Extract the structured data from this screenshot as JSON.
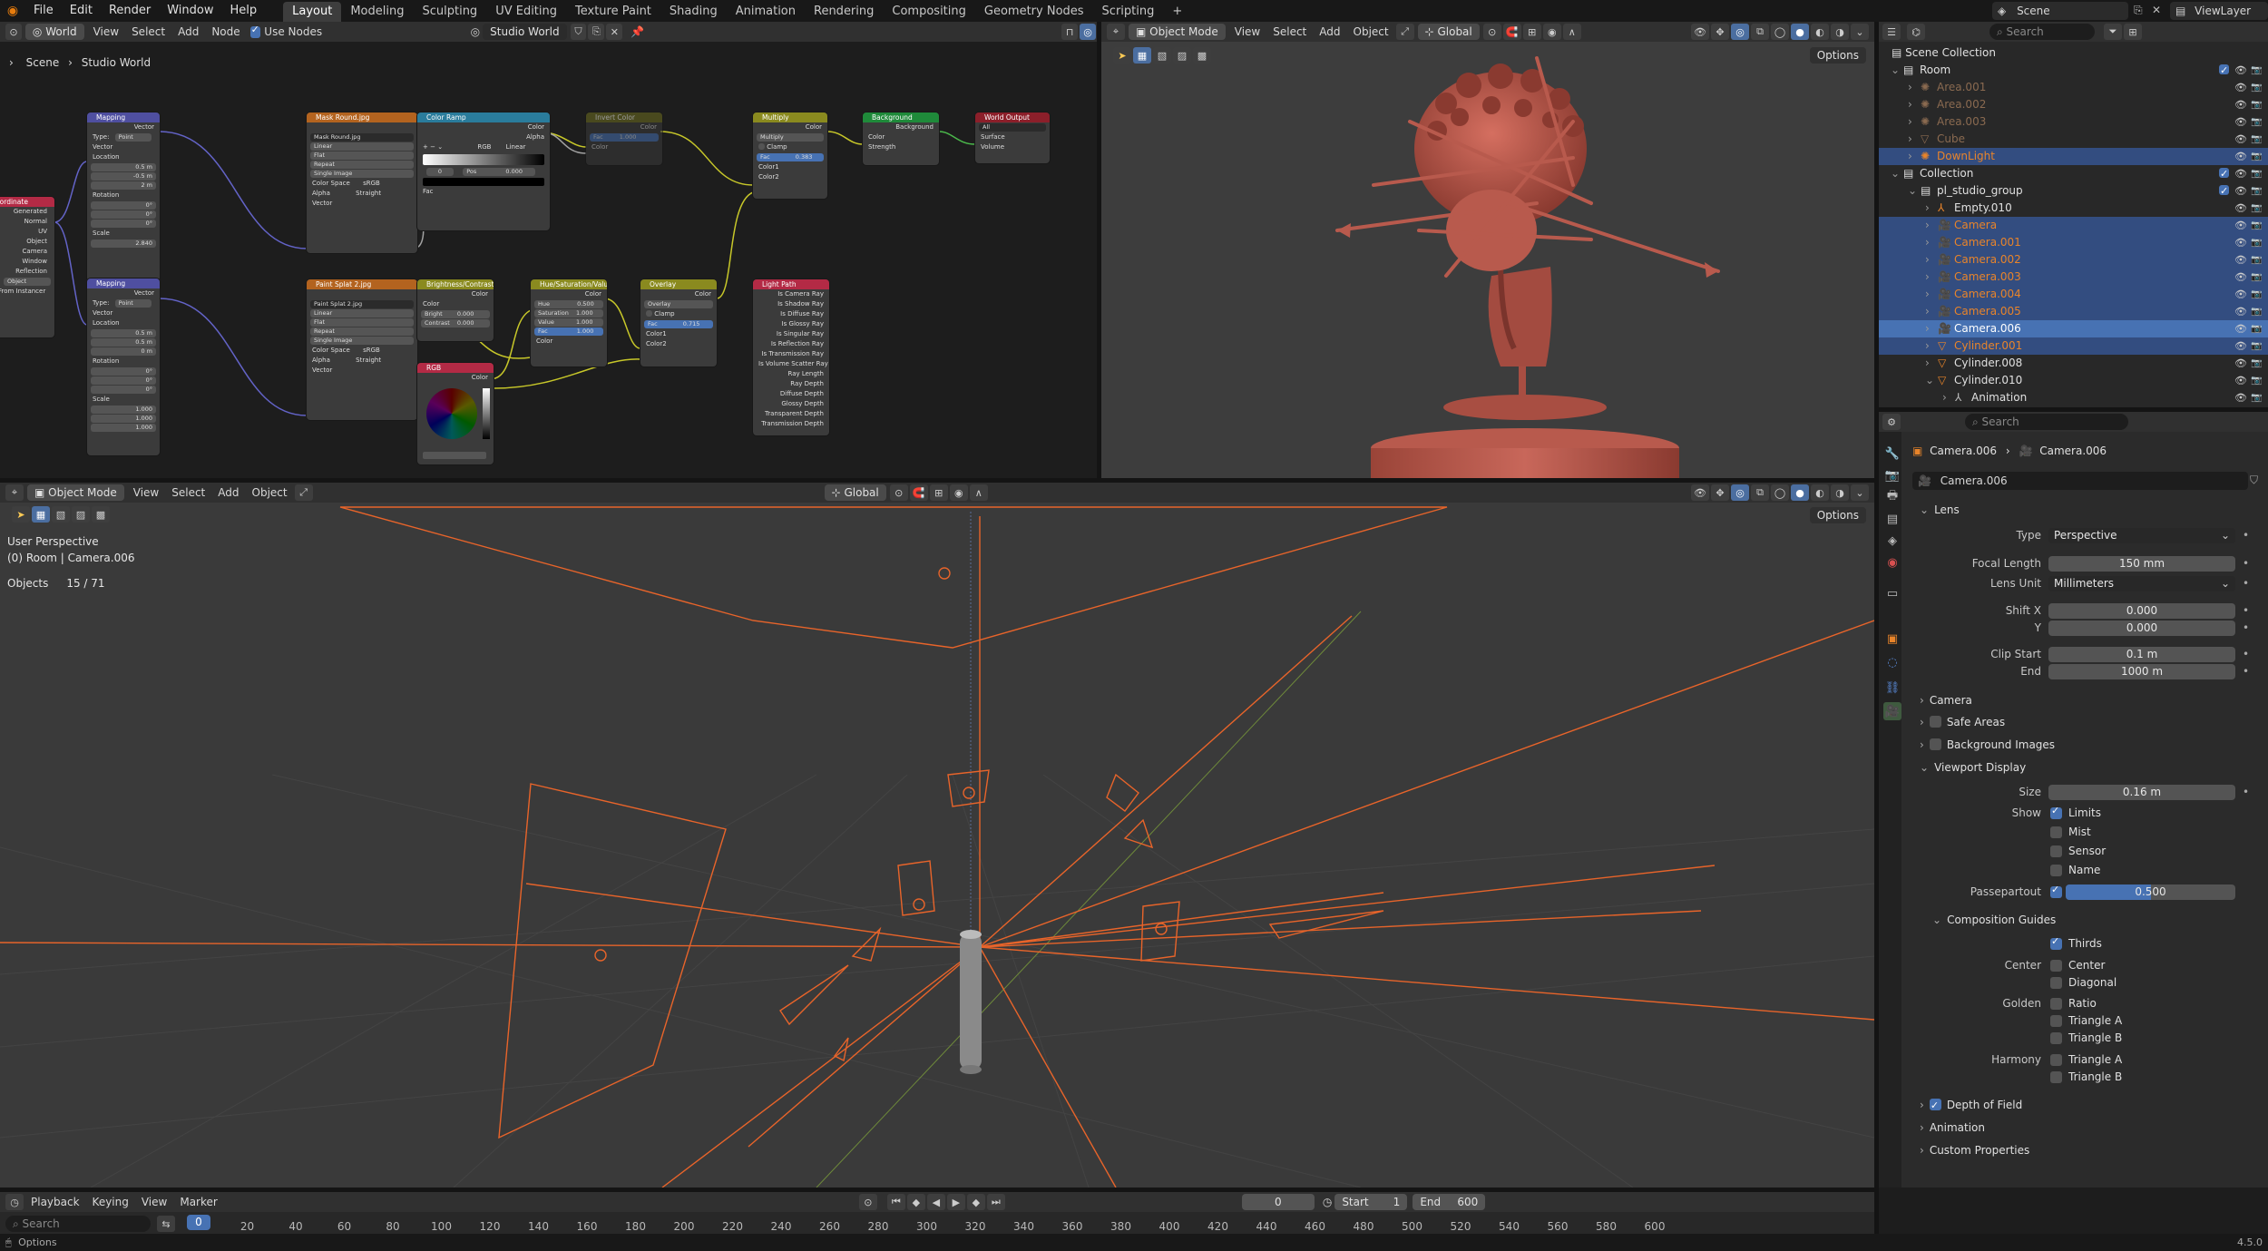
{
  "topbar": {
    "menus": [
      "File",
      "Edit",
      "Render",
      "Window",
      "Help"
    ],
    "workspaces": [
      "Layout",
      "Modeling",
      "Sculpting",
      "UV Editing",
      "Texture Paint",
      "Shading",
      "Animation",
      "Rendering",
      "Compositing",
      "Geometry Nodes",
      "Scripting"
    ],
    "active_workspace": "Layout",
    "add_tab": "+",
    "scene_name": "Scene",
    "view_layer": "ViewLayer"
  },
  "node_editor": {
    "header": {
      "editor": "World",
      "menus": [
        "View",
        "Select",
        "Add",
        "Node"
      ],
      "use_nodes": "Use Nodes",
      "world_name": "Studio World"
    },
    "breadcrumb": {
      "scene": "Scene",
      "world": "Studio World"
    },
    "nodes": {
      "texcoord": {
        "title": "Texture Coordinate",
        "outputs": [
          "Generated",
          "Normal",
          "UV",
          "Object",
          "Camera",
          "Window",
          "Reflection"
        ],
        "object_field": "Object",
        "from_instancer": "From Instancer"
      },
      "mapping1": {
        "title": "Mapping",
        "out": "Vector",
        "type_label": "Type:",
        "type_val": "Point",
        "vector": "Vector",
        "location": "Location",
        "loc": [
          "0.5 m",
          "-0.5 m",
          "2 m"
        ],
        "rotation": "Rotation",
        "rot": [
          "0°",
          "0°",
          "0°"
        ],
        "scale": "Scale",
        "scl": [
          "2.840"
        ]
      },
      "mapping2": {
        "title": "Mapping",
        "out": "Vector",
        "type_label": "Type:",
        "type_val": "Point",
        "vector": "Vector",
        "location": "Location",
        "loc": [
          "0.5 m",
          "0.5 m",
          "0 m"
        ],
        "rotation": "Rotation",
        "rot": [
          "0°",
          "0°",
          "0°"
        ],
        "scale": "Scale",
        "scl": [
          "1.000",
          "1.000",
          "1.000"
        ]
      },
      "mask": {
        "title": "Mask Round.jpg",
        "img": "Mask Round.jpg",
        "rows": [
          "Linear",
          "Flat",
          "Repeat",
          "Single Image"
        ],
        "cs_label": "Color Space",
        "cs_val": "sRGB",
        "alpha_label": "Alpha",
        "alpha_val": "Straight",
        "vector": "Vector"
      },
      "colorramp": {
        "title": "Color Ramp",
        "color": "Color",
        "alpha": "Alpha",
        "mode": "RGB",
        "interp": "Linear",
        "pos_idx": "0",
        "pos_label": "Pos",
        "pos_val": "0.000",
        "fac": "Fac"
      },
      "invert": {
        "title": "Invert Color",
        "color": "Color",
        "fac": "Fac",
        "fac_val": "1.000",
        "color_in": "Color"
      },
      "paint": {
        "title": "Paint Splat 2.jpg",
        "img": "Paint Splat 2.jpg",
        "rows": [
          "Linear",
          "Flat",
          "Repeat",
          "Single Image"
        ],
        "cs_label": "Color Space",
        "cs_val": "sRGB",
        "alpha_label": "Alpha",
        "alpha_val": "Straight",
        "vector": "Vector"
      },
      "bright": {
        "title": "Brightness/Contrast",
        "color": "Color",
        "color_in": "Color",
        "bright": "Bright",
        "bright_val": "0.000",
        "contrast": "Contrast",
        "contrast_val": "0.000"
      },
      "rgb": {
        "title": "RGB",
        "color": "Color"
      },
      "hsv": {
        "title": "Hue/Saturation/Value",
        "color": "Color",
        "hue": "Hue",
        "hue_val": "0.500",
        "sat": "Saturation",
        "sat_val": "1.000",
        "val": "Value",
        "val_val": "1.000",
        "fac": "Fac",
        "fac_val": "1.000",
        "color_in": "Color"
      },
      "overlay": {
        "title": "Overlay",
        "color": "Color",
        "mode": "Overlay",
        "clamp": "Clamp",
        "fac": "Fac",
        "fac_val": "0.715",
        "c1": "Color1",
        "c2": "Color2"
      },
      "multiply": {
        "title": "Multiply",
        "color": "Color",
        "mode": "Multiply",
        "clamp": "Clamp",
        "fac": "Fac",
        "fac_val": "0.383",
        "c1": "Color1",
        "c2": "Color2"
      },
      "lightpath": {
        "title": "Light Path",
        "outs": [
          "Is Camera Ray",
          "Is Shadow Ray",
          "Is Diffuse Ray",
          "Is Glossy Ray",
          "Is Singular Ray",
          "Is Reflection Ray",
          "Is Transmission Ray",
          "Is Volume Scatter Ray",
          "Ray Length",
          "Ray Depth",
          "Diffuse Depth",
          "Glossy Depth",
          "Transparent Depth",
          "Transmission Depth"
        ]
      },
      "background": {
        "title": "Background",
        "background": "Background",
        "color": "Color",
        "strength": "Strength"
      },
      "worldout": {
        "title": "World Output",
        "target": "All",
        "surface": "Surface",
        "volume": "Volume"
      }
    }
  },
  "top_viewport": {
    "header": {
      "mode": "Object Mode",
      "menus": [
        "View",
        "Select",
        "Add",
        "Object"
      ],
      "orientation": "Global"
    },
    "options": "Options"
  },
  "main_viewport": {
    "header": {
      "mode": "Object Mode",
      "menus": [
        "View",
        "Select",
        "Add",
        "Object"
      ],
      "orientation": "Global"
    },
    "options": "Options",
    "overlay": {
      "view": "User Perspective",
      "context": "(0) Room | Camera.006",
      "objects_label": "Objects",
      "objects_count": "15 / 71"
    }
  },
  "outliner": {
    "search_placeholder": "Search",
    "root": "Scene Collection",
    "rows": [
      {
        "label": "Room",
        "indent": 1,
        "type": "collection",
        "sel": false
      },
      {
        "label": "Area.001",
        "indent": 2,
        "type": "light-dim",
        "sel": false
      },
      {
        "label": "Area.002",
        "indent": 2,
        "type": "light-dim",
        "sel": false
      },
      {
        "label": "Area.003",
        "indent": 2,
        "type": "light-dim",
        "sel": false
      },
      {
        "label": "Cube",
        "indent": 2,
        "type": "mesh-dim",
        "sel": false
      },
      {
        "label": "DownLight",
        "indent": 2,
        "type": "light",
        "sel": true
      },
      {
        "label": "Collection",
        "indent": 1,
        "type": "collection",
        "sel": false
      },
      {
        "label": "pl_studio_group",
        "indent": 2,
        "type": "collection",
        "sel": false
      },
      {
        "label": "Empty.010",
        "indent": 3,
        "type": "empty",
        "sel": false
      },
      {
        "label": "Camera",
        "indent": 3,
        "type": "camera",
        "sel": true
      },
      {
        "label": "Camera.001",
        "indent": 3,
        "type": "camera",
        "sel": true
      },
      {
        "label": "Camera.002",
        "indent": 3,
        "type": "camera",
        "sel": true
      },
      {
        "label": "Camera.003",
        "indent": 3,
        "type": "camera",
        "sel": true
      },
      {
        "label": "Camera.004",
        "indent": 3,
        "type": "camera",
        "sel": true
      },
      {
        "label": "Camera.005",
        "indent": 3,
        "type": "camera",
        "sel": true
      },
      {
        "label": "Camera.006",
        "indent": 3,
        "type": "camera",
        "sel": "active"
      },
      {
        "label": "Cylinder.001",
        "indent": 3,
        "type": "mesh",
        "sel": true
      },
      {
        "label": "Cylinder.008",
        "indent": 3,
        "type": "mesh-w",
        "sel": false
      },
      {
        "label": "Cylinder.010",
        "indent": 3,
        "type": "mesh-w",
        "sel": false
      },
      {
        "label": "Animation",
        "indent": 4,
        "type": "anim",
        "sel": false
      }
    ]
  },
  "properties": {
    "search_placeholder": "Search",
    "breadcrumb": [
      "Camera.006",
      "Camera.006"
    ],
    "data_name": "Camera.006",
    "lens": {
      "title": "Lens",
      "type_label": "Type",
      "type_val": "Perspective",
      "focal_label": "Focal Length",
      "focal_val": "150 mm",
      "unit_label": "Lens Unit",
      "unit_val": "Millimeters",
      "shiftx_label": "Shift X",
      "shiftx_val": "0.000",
      "shifty_label": "Y",
      "shifty_val": "0.000",
      "clipstart_label": "Clip Start",
      "clipstart_val": "0.1 m",
      "clipend_label": "End",
      "clipend_val": "1000 m"
    },
    "camera": "Camera",
    "safe_areas": "Safe Areas",
    "bg_images": "Background Images",
    "viewport_display": {
      "title": "Viewport Display",
      "size_label": "Size",
      "size_val": "0.16 m",
      "show_label": "Show",
      "limits": "Limits",
      "mist": "Mist",
      "sensor": "Sensor",
      "name": "Name",
      "passepartout_label": "Passepartout",
      "passepartout_val": "0.500",
      "passepartout_fill": 0.5
    },
    "composition": {
      "title": "Composition Guides",
      "thirds": "Thirds",
      "center_label": "Center",
      "center": "Center",
      "diagonal": "Diagonal",
      "golden_label": "Golden",
      "ratio": "Ratio",
      "tri_a": "Triangle A",
      "tri_b": "Triangle B",
      "harmony_label": "Harmony",
      "htri_a": "Triangle A",
      "htri_b": "Triangle B"
    },
    "dof": "Depth of Field",
    "animation": "Animation",
    "custom": "Custom Properties"
  },
  "timeline": {
    "menus": [
      "Playback",
      "Keying",
      "View",
      "Marker"
    ],
    "current_frame": "0",
    "start_label": "Start",
    "start_val": "1",
    "end_label": "End",
    "end_val": "600",
    "frame_box": "0",
    "ticks": [
      "0",
      "20",
      "40",
      "60",
      "80",
      "100",
      "120",
      "140",
      "160",
      "180",
      "200",
      "220",
      "240",
      "260",
      "280",
      "300",
      "320",
      "340",
      "360",
      "380",
      "400",
      "420",
      "440",
      "460",
      "480",
      "500",
      "520",
      "540",
      "560",
      "580",
      "600"
    ],
    "search_placeholder": "Search"
  },
  "statusbar": {
    "left": "Options",
    "version": "4.5.0"
  },
  "colors": {
    "accent": "#4772b3",
    "selected_row": "#334d80",
    "camera_orange": "#e8642a",
    "model": "#c2594c"
  }
}
